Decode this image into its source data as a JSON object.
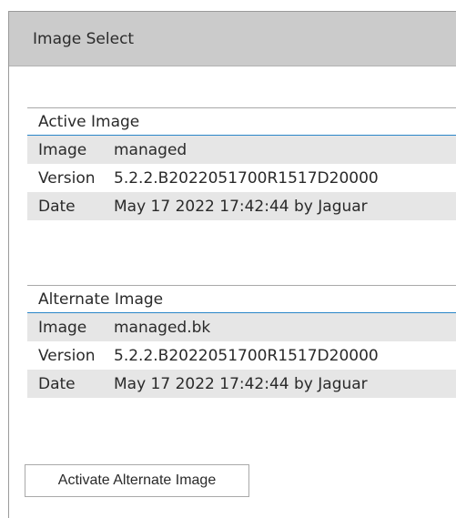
{
  "header": {
    "title": "Image Select"
  },
  "active_image": {
    "title": "Active Image",
    "rows": [
      {
        "key": "Image",
        "value": "managed"
      },
      {
        "key": "Version",
        "value": "5.2.2.B2022051700R1517D20000"
      },
      {
        "key": "Date",
        "value": "May 17 2022 17:42:44 by Jaguar"
      }
    ]
  },
  "alternate_image": {
    "title": "Alternate Image",
    "rows": [
      {
        "key": "Image",
        "value": "managed.bk"
      },
      {
        "key": "Version",
        "value": "5.2.2.B2022051700R1517D20000"
      },
      {
        "key": "Date",
        "value": "May 17 2022 17:42:44 by Jaguar"
      }
    ]
  },
  "actions": {
    "activate_label": "Activate Alternate Image"
  }
}
